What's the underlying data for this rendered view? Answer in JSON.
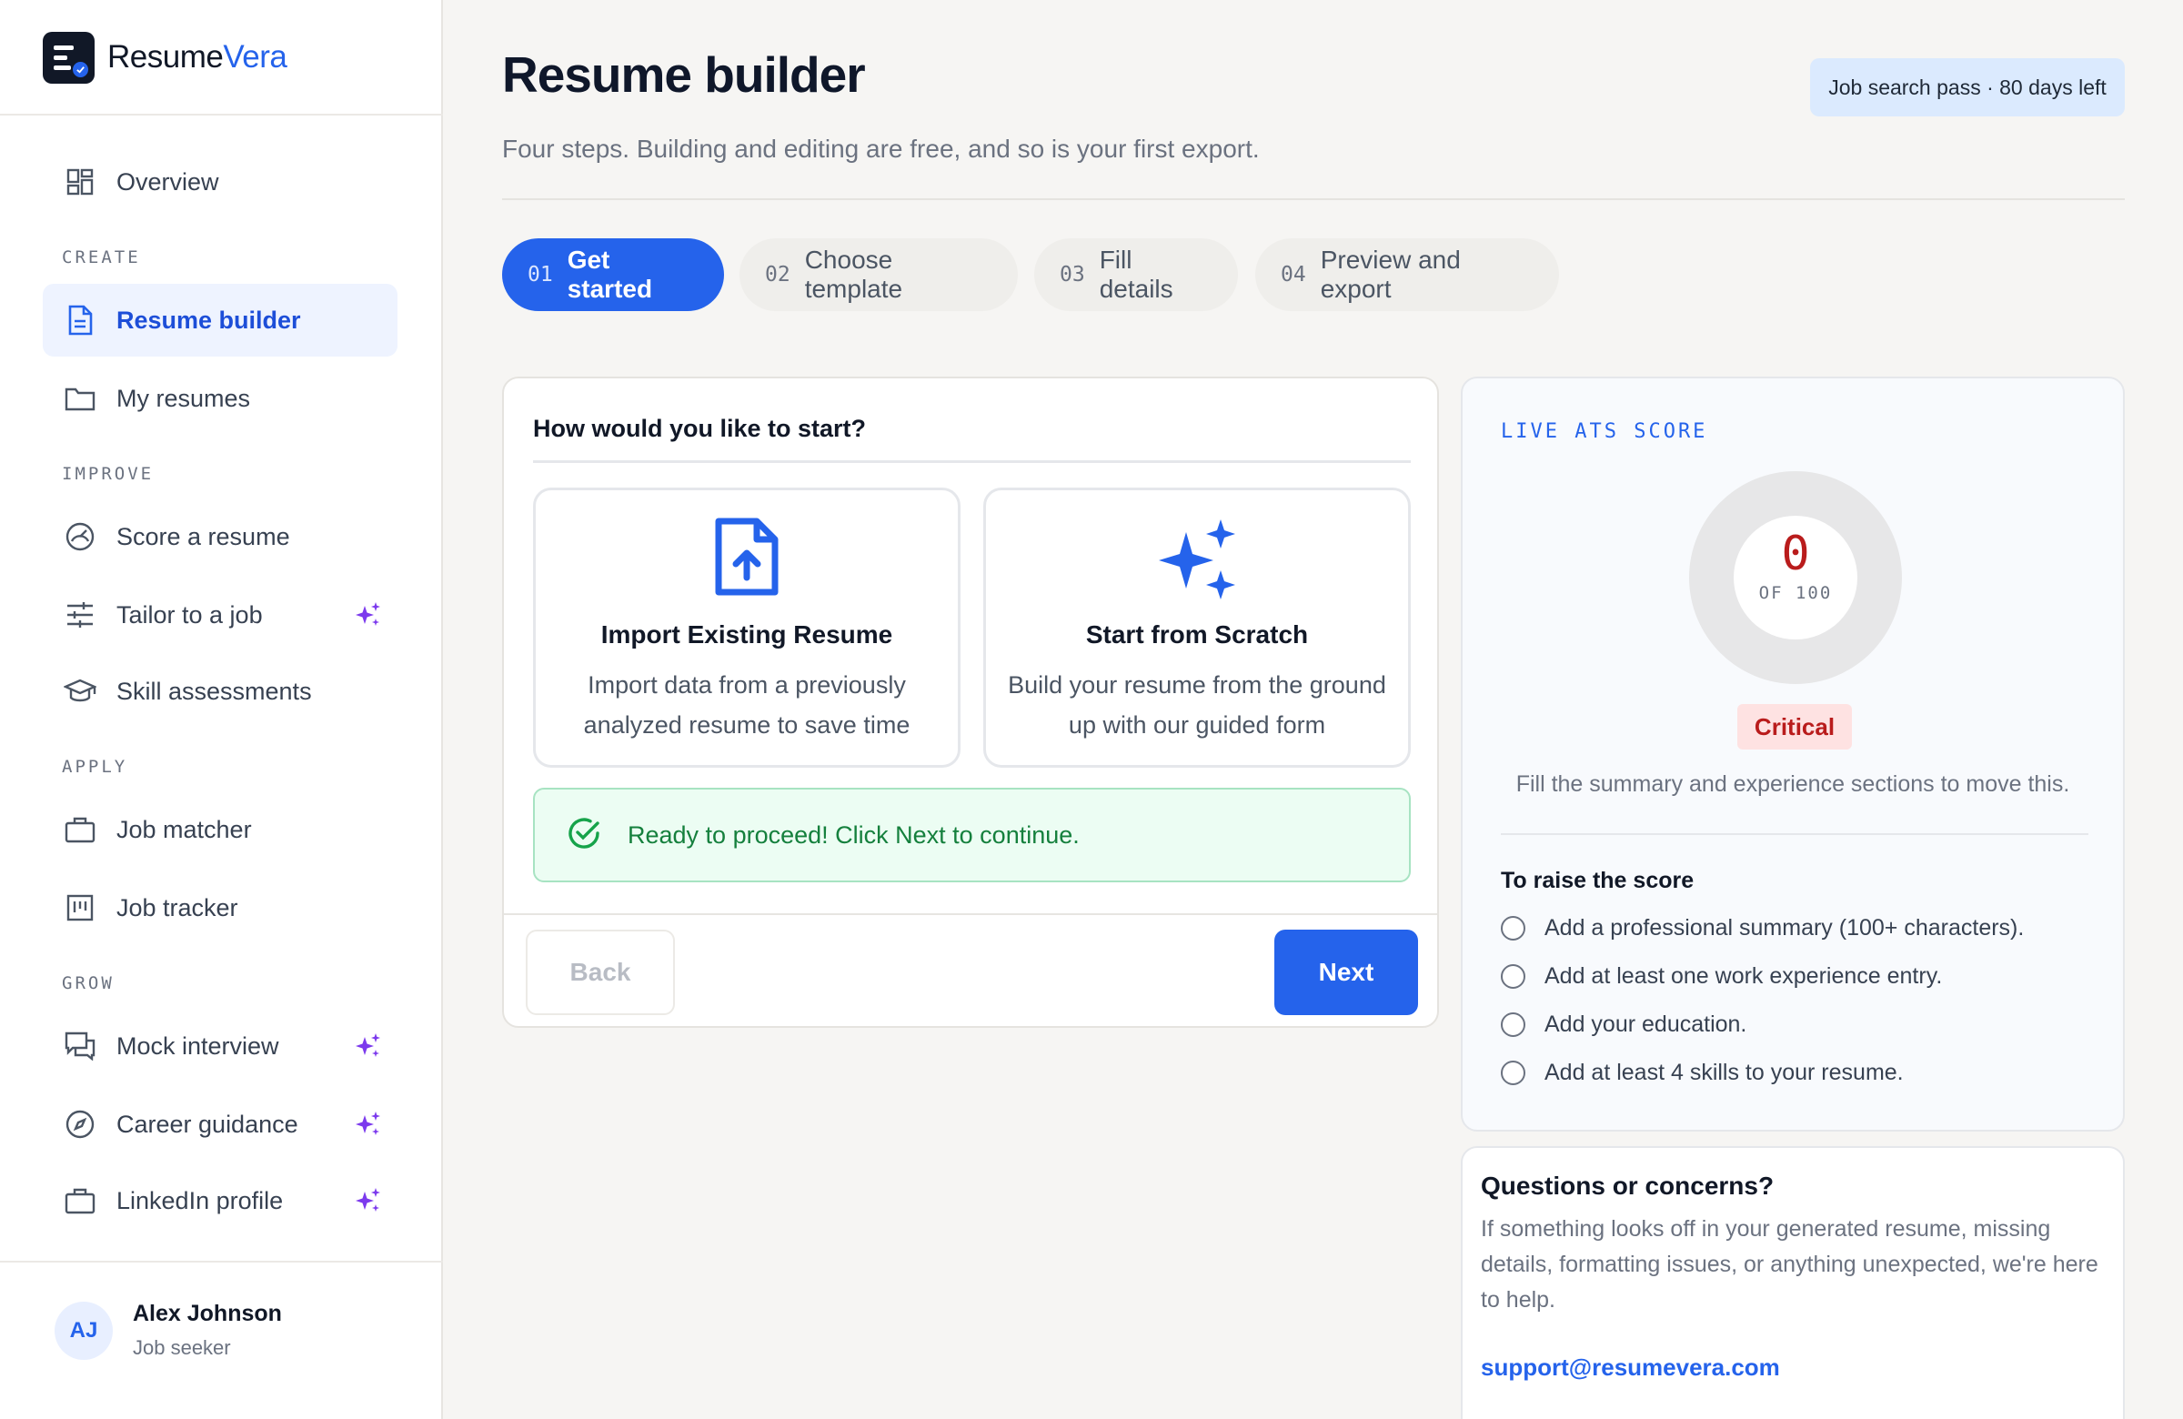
{
  "brand": {
    "name_main": "Resume",
    "name_accent": "Vera"
  },
  "sidebar": {
    "items": [
      {
        "label": "Overview"
      },
      {
        "label": "Resume builder"
      },
      {
        "label": "My resumes"
      },
      {
        "label": "Score a resume"
      },
      {
        "label": "Tailor to a job"
      },
      {
        "label": "Skill assessments"
      },
      {
        "label": "Job matcher"
      },
      {
        "label": "Job tracker"
      },
      {
        "label": "Mock interview"
      },
      {
        "label": "Career guidance"
      },
      {
        "label": "LinkedIn profile"
      }
    ],
    "sections": [
      "CREATE",
      "IMPROVE",
      "APPLY",
      "GROW"
    ],
    "active_item": "Resume builder",
    "user": {
      "initials": "AJ",
      "name": "Alex Johnson",
      "role": "Job seeker"
    }
  },
  "header": {
    "title": "Resume builder",
    "subtitle": "Four steps. Building and editing are free, and so is your first export.",
    "pass_badge": "Job search pass · 80 days left"
  },
  "steps": [
    {
      "num": "01",
      "label": "Get started"
    },
    {
      "num": "02",
      "label": "Choose template"
    },
    {
      "num": "03",
      "label": "Fill details"
    },
    {
      "num": "04",
      "label": "Preview and export"
    }
  ],
  "start": {
    "heading": "How would you like to start?",
    "options": [
      {
        "title": "Import Existing Resume",
        "desc": "Import data from a previously analyzed resume to save time"
      },
      {
        "title": "Start from Scratch",
        "desc": "Build your resume from the ground up with our guided form"
      }
    ],
    "ready_message": "Ready to proceed! Click Next to continue.",
    "back_label": "Back",
    "next_label": "Next"
  },
  "ats": {
    "heading": "LIVE ATS SCORE",
    "score": "0",
    "of_label": "OF 100",
    "status": "Critical",
    "hint": "Fill the summary and experience sections to move this.",
    "raise_title": "To raise the score",
    "raise_items": [
      "Add a professional summary (100+ characters).",
      "Add at least one work experience entry.",
      "Add your education.",
      "Add at least 4 skills to your resume."
    ]
  },
  "help": {
    "title": "Questions or concerns?",
    "text": "If something looks off in your generated resume, missing details, formatting issues, or anything unexpected, we're here to help.",
    "email": "support@resumevera.com"
  },
  "colors": {
    "accent": "#2563eb",
    "critical": "#b91c1c",
    "success": "#15803d",
    "ai_spark": "#7c3aed"
  }
}
